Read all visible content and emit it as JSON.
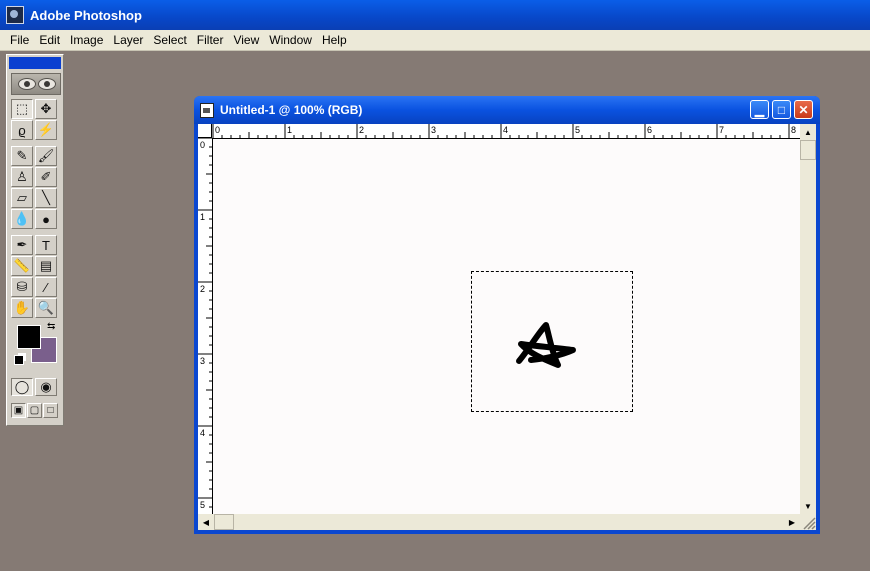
{
  "app": {
    "title": "Adobe Photoshop",
    "menu": [
      "File",
      "Edit",
      "Image",
      "Layer",
      "Select",
      "Filter",
      "View",
      "Window",
      "Help"
    ]
  },
  "toolbox": {
    "tools": [
      {
        "name": "marquee-tool-icon",
        "glyph": "⬚"
      },
      {
        "name": "move-tool-icon",
        "glyph": "✥"
      },
      {
        "name": "lasso-tool-icon",
        "glyph": "ϱ"
      },
      {
        "name": "magic-wand-tool-icon",
        "glyph": "⚡"
      },
      {
        "name": "airbrush-tool-icon",
        "glyph": "✎"
      },
      {
        "name": "paintbrush-tool-icon",
        "glyph": "🖌"
      },
      {
        "name": "rubber-stamp-tool-icon",
        "glyph": "♙"
      },
      {
        "name": "history-brush-tool-icon",
        "glyph": "✐"
      },
      {
        "name": "eraser-tool-icon",
        "glyph": "▱"
      },
      {
        "name": "pencil-tool-icon",
        "glyph": "╲"
      },
      {
        "name": "blur-tool-icon",
        "glyph": "💧"
      },
      {
        "name": "burn-tool-icon",
        "glyph": "●"
      },
      {
        "name": "pen-tool-icon",
        "glyph": "✒"
      },
      {
        "name": "type-tool-icon",
        "glyph": "T"
      },
      {
        "name": "measure-tool-icon",
        "glyph": "📏"
      },
      {
        "name": "gradient-tool-icon",
        "glyph": "▤"
      },
      {
        "name": "paint-bucket-tool-icon",
        "glyph": "⛁"
      },
      {
        "name": "eyedropper-tool-icon",
        "glyph": "⁄"
      },
      {
        "name": "hand-tool-icon",
        "glyph": "✋"
      },
      {
        "name": "zoom-tool-icon",
        "glyph": "🔍"
      },
      {
        "name": "standard-mode-icon",
        "glyph": "◯"
      },
      {
        "name": "quick-mask-mode-icon",
        "glyph": "◉"
      },
      {
        "name": "standard-screen-icon",
        "glyph": "▣"
      },
      {
        "name": "full-screen-menu-icon",
        "glyph": "▢"
      },
      {
        "name": "full-screen-icon",
        "glyph": "□"
      }
    ],
    "foreground_color": "#000000",
    "background_color": "#7a5f8c"
  },
  "document": {
    "title": "Untitled-1 @ 100% (RGB)",
    "ruler_top_labels": [
      "0",
      "1",
      "2",
      "3",
      "4",
      "5",
      "6",
      "7",
      "8"
    ],
    "ruler_left_labels": [
      "0",
      "1",
      "2",
      "3",
      "4",
      "5"
    ]
  }
}
